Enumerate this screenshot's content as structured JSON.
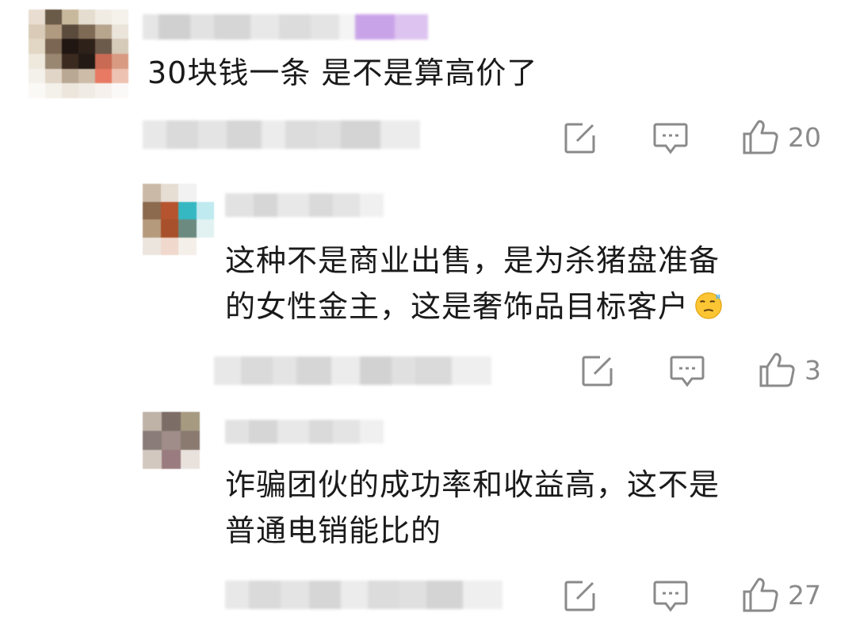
{
  "comments": [
    {
      "text": "30块钱一条 是不是算高价了",
      "actions": {
        "share_icon": "edit-square-icon",
        "reply_icon": "comment-bubble-icon",
        "like_icon": "thumbs-up-icon",
        "like_count": "20"
      }
    },
    {
      "line1": "这种不是商业出售，是为杀猪盘准备",
      "line2": "的女性金主，这是奢饰品目标客户",
      "emoji": "sweat-smile-emoji-icon",
      "actions": {
        "share_icon": "edit-square-icon",
        "reply_icon": "comment-bubble-icon",
        "like_icon": "thumbs-up-icon",
        "like_count": "3"
      }
    },
    {
      "line1": "诈骗团伙的成功率和收益高，这不是",
      "line2": "普通电销能比的",
      "actions": {
        "share_icon": "edit-square-icon",
        "reply_icon": "comment-bubble-icon",
        "like_icon": "thumbs-up-icon",
        "like_count": "27"
      }
    }
  ],
  "colors": {
    "text": "#1a1a1a",
    "icon": "#8a8a8a",
    "blur": "#d9d9d9",
    "accent_tag": "#c9a3e8"
  }
}
